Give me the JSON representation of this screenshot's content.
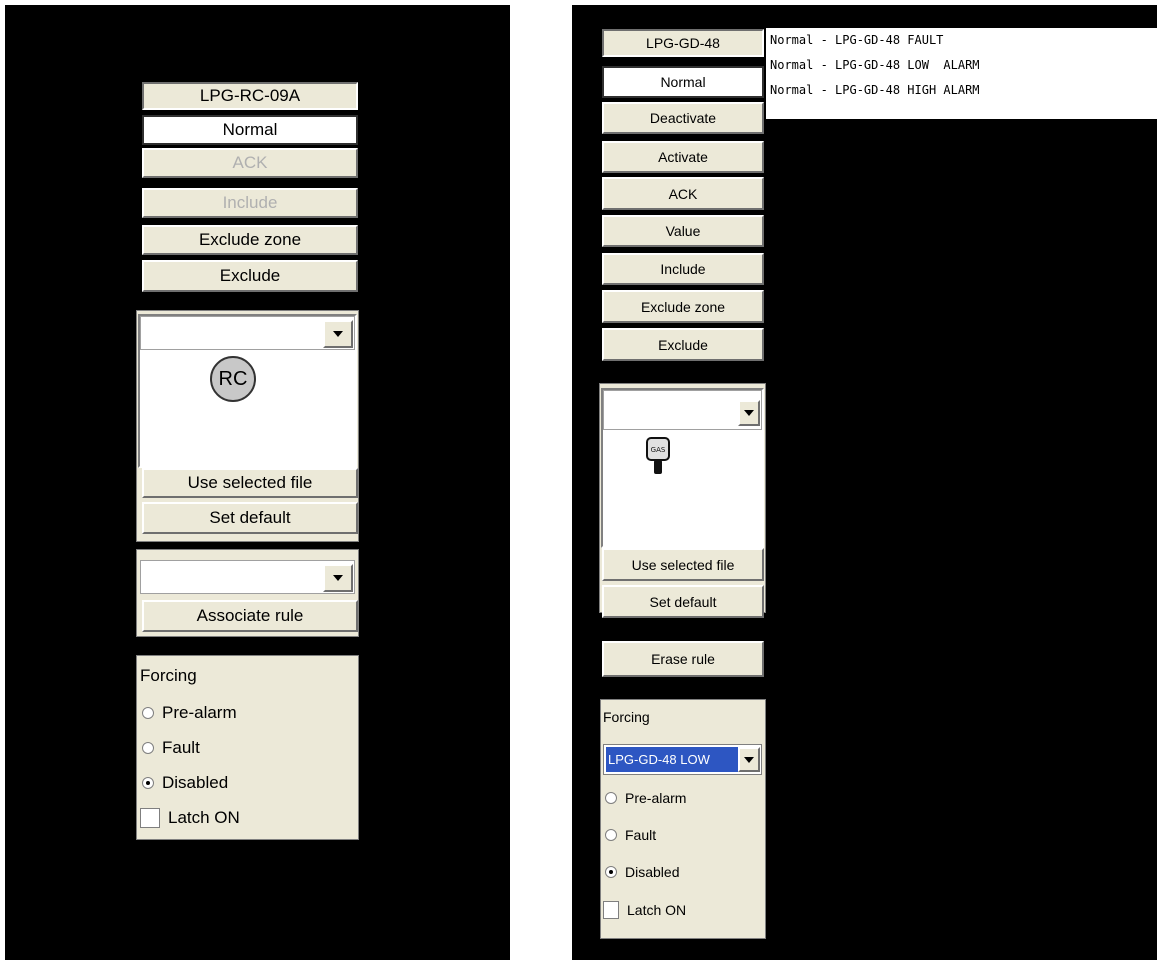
{
  "left": {
    "tag": "LPG-RC-09A",
    "status": "Normal",
    "buttons": {
      "ack": "ACK",
      "include": "Include",
      "exclude_zone": "Exclude zone",
      "exclude": "Exclude",
      "use_selected_file": "Use selected file",
      "set_default": "Set default",
      "associate_rule": "Associate rule"
    },
    "symbol_text": "RC",
    "forcing": {
      "label": "Forcing",
      "options": [
        "Pre-alarm",
        "Fault",
        "Disabled"
      ],
      "selected": "Disabled",
      "latch_label": "Latch ON"
    }
  },
  "right": {
    "tag": "LPG-GD-48",
    "status": "Normal",
    "buttons": {
      "deactivate": "Deactivate",
      "activate": "Activate",
      "ack": "ACK",
      "value": "Value",
      "include": "Include",
      "exclude_zone": "Exclude zone",
      "exclude": "Exclude",
      "use_selected_file": "Use selected file",
      "set_default": "Set default",
      "erase_rule": "Erase rule"
    },
    "symbol_text": "GAS",
    "forcing": {
      "label": "Forcing",
      "selected_value": "LPG-GD-48 LOW",
      "options": [
        "Pre-alarm",
        "Fault",
        "Disabled"
      ],
      "selected": "Disabled",
      "latch_label": "Latch ON"
    },
    "alarm_list": [
      "Normal - LPG-GD-48 FAULT",
      "Normal - LPG-GD-48 LOW  ALARM",
      "Normal - LPG-GD-48 HIGH ALARM"
    ]
  },
  "colors": {
    "background": "#000000",
    "button_face": "#ece9d8",
    "selection": "#2d56c2",
    "disabled_text": "#b0b0b0"
  }
}
